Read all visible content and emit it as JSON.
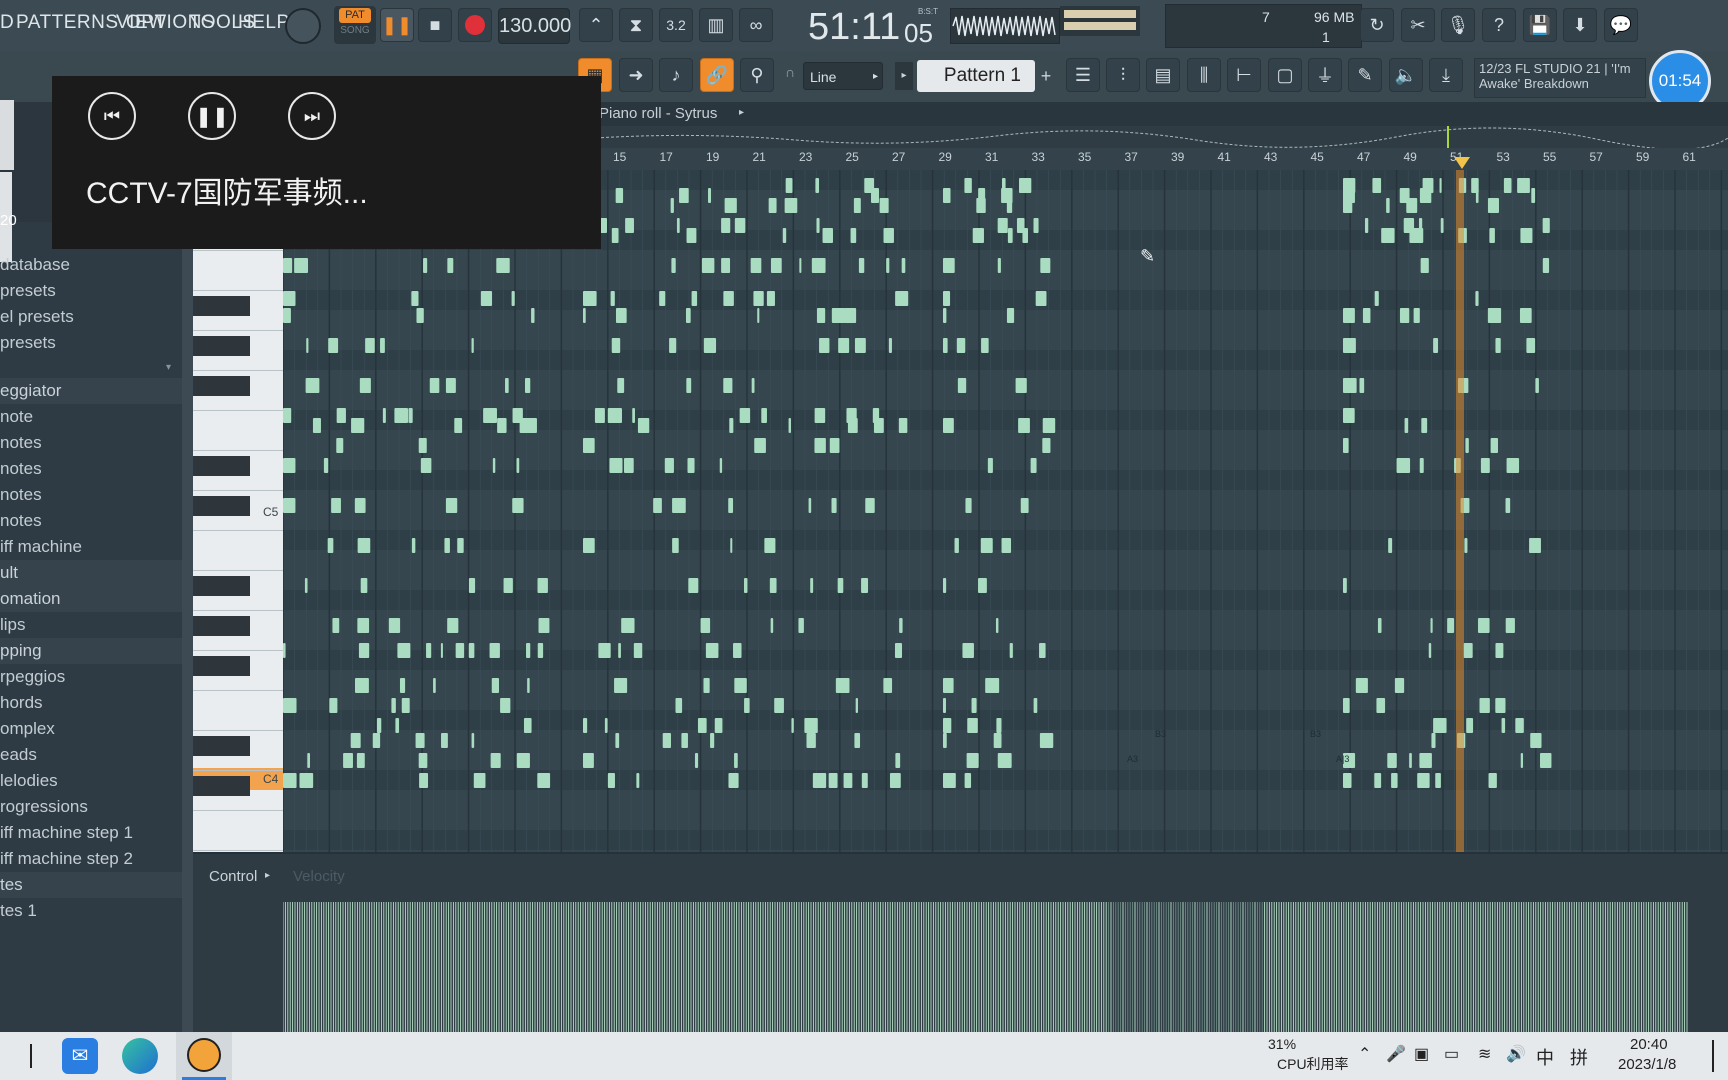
{
  "menu": {
    "items": [
      "D",
      "PATTERNS",
      "VIEW",
      "OPTIONS",
      "TOOLS",
      "HELP"
    ]
  },
  "transport": {
    "pat_label": "PAT",
    "song_label": "SONG",
    "tempo": "130.000",
    "time_display": "51:11",
    "time_ticks": "05",
    "time_mode": "B:S:T",
    "cpu_value": "7",
    "ram_value": "96 MB",
    "voices": "1"
  },
  "toolbar2": {
    "snap_label": "Line",
    "pattern_label": "Pattern 1",
    "hint_line1": "12/23  FL STUDIO 21 | 'I'm",
    "hint_line2": "Awake' Breakdown",
    "clock": "01:54"
  },
  "piano_roll": {
    "title": "Piano roll - Sytrus",
    "ruler": [
      "15",
      "17",
      "19",
      "21",
      "23",
      "25",
      "27",
      "29",
      "31",
      "33",
      "35",
      "37",
      "39",
      "41",
      "43",
      "45",
      "47",
      "49",
      "51",
      "53",
      "55",
      "57",
      "59",
      "61"
    ],
    "key_labels": [
      "C5",
      "C4"
    ],
    "note_labels": [
      "B3",
      "B3",
      "A3",
      "A|3"
    ],
    "control_label": "Control",
    "velocity_label": "Velocity"
  },
  "sidebar": {
    "items": [
      {
        "label": "database",
        "head": false
      },
      {
        "label": "presets",
        "head": false
      },
      {
        "label": "el presets",
        "head": false
      },
      {
        "label": "presets",
        "head": false
      },
      {
        "label": "eggiator",
        "head": true
      },
      {
        "label": "note",
        "head": false
      },
      {
        "label": "notes",
        "head": false
      },
      {
        "label": "notes",
        "head": false
      },
      {
        "label": "notes",
        "head": false
      },
      {
        "label": "notes",
        "head": false
      },
      {
        "label": "iff machine",
        "head": false
      },
      {
        "label": "ult",
        "head": true
      },
      {
        "label": "omation",
        "head": true
      },
      {
        "label": "lips",
        "head": false
      },
      {
        "label": "pping",
        "head": true
      },
      {
        "label": "rpeggios",
        "head": false
      },
      {
        "label": "hords",
        "head": false
      },
      {
        "label": "omplex",
        "head": false
      },
      {
        "label": "eads",
        "head": false
      },
      {
        "label": "lelodies",
        "head": false
      },
      {
        "label": "rogressions",
        "head": false
      },
      {
        "label": "iff machine step 1",
        "head": false
      },
      {
        "label": "iff machine step 2",
        "head": false
      },
      {
        "label": "tes",
        "head": true
      },
      {
        "label": "tes 1",
        "head": false
      }
    ],
    "peek_number": "20"
  },
  "media_overlay": {
    "title": "CCTV-7国防军事频..."
  },
  "taskbar": {
    "cpu_percent": "31%",
    "cpu_label": "CPU利用率",
    "ime": "中",
    "ime2": "拼",
    "time": "20:40",
    "date": "2023/1/8"
  },
  "colors": {
    "accent": "#f08c2c",
    "note": "#a9dcc0",
    "grid": "#34454f",
    "playhead": "#e08a2c"
  }
}
